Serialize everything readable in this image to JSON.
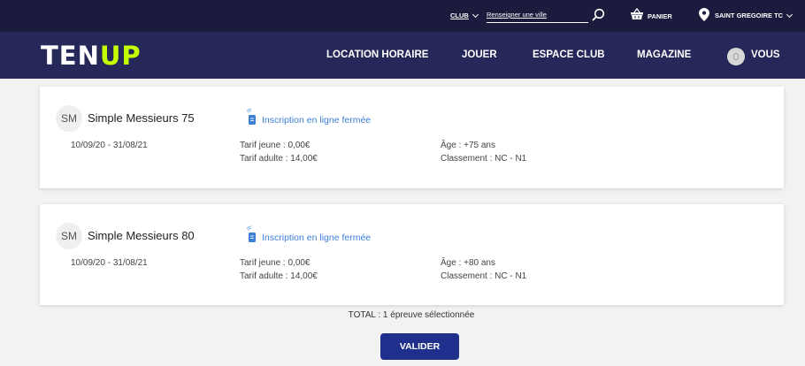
{
  "topbar": {
    "club_label": "CLUB",
    "city_placeholder": "Renseigner une ville",
    "cart_label": "PANIER",
    "location_label": "SAINT GREGOIRE TC"
  },
  "navbar": {
    "logo_left": "TEN",
    "logo_right": "UP",
    "items": [
      {
        "label": "LOCATION HORAIRE"
      },
      {
        "label": "JOUER"
      },
      {
        "label": "ESPACE CLUB"
      },
      {
        "label": "MAGAZINE"
      },
      {
        "label": "VOUS"
      }
    ]
  },
  "events": [
    {
      "initials": "SM",
      "name": "Simple Messieurs 75",
      "status": "Inscription en ligne fermée",
      "dates": "10/09/20 - 31/08/21",
      "tarif_jeune": "Tarif jeune : 0,00€",
      "tarif_adulte": "Tarif adulte : 14,00€",
      "age": "Âge : +75 ans",
      "classement": "Classement : NC - N1"
    },
    {
      "initials": "SM",
      "name": "Simple Messieurs 80",
      "status": "Inscription en ligne fermée",
      "dates": "10/09/20 - 31/08/21",
      "tarif_jeune": "Tarif jeune : 0,00€",
      "tarif_adulte": "Tarif adulte : 14,00€",
      "age": "Âge : +80 ans",
      "classement": "Classement : NC - N1"
    }
  ],
  "footer": {
    "total": "TOTAL : 1 épreuve sélectionnée",
    "validate_label": "VALIDER"
  },
  "colors": {
    "topbar": "#1b1c3d",
    "navbar": "#27285a",
    "logo_accent": "#c6ff00",
    "link": "#3d7fd6",
    "button": "#1f2f8c"
  },
  "icons": [
    "chevron-down-icon",
    "search-icon",
    "basket-icon",
    "location-pin-icon",
    "user-avatar-icon",
    "online-registration-icon"
  ]
}
